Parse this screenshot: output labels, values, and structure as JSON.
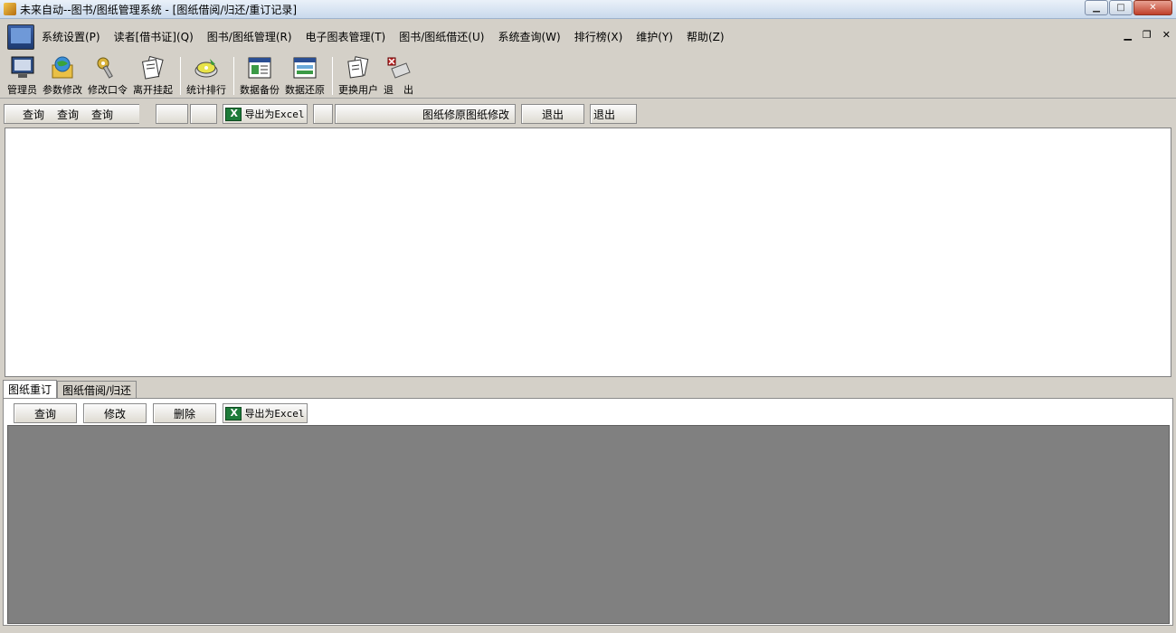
{
  "window": {
    "title": "未来自动--图书/图纸管理系统 - [图纸借阅/归还/重订记录]"
  },
  "menu": {
    "items": [
      "系统设置(P)",
      "读者[借书证](Q)",
      "图书/图纸管理(R)",
      "电子图表管理(T)",
      "图书/图纸借还(U)",
      "系统查询(W)",
      "排行榜(X)",
      "维护(Y)",
      "帮助(Z)"
    ]
  },
  "toolbar": {
    "tools": [
      {
        "label": "管理员",
        "icon": "admin-monitor-icon"
      },
      {
        "label": "参数修改",
        "icon": "globe-folder-icon"
      },
      {
        "label": "修改口令",
        "icon": "key-icon"
      },
      {
        "label": "离开挂起",
        "icon": "documents-icon"
      },
      {
        "label": "统计排行",
        "icon": "disc-icon"
      },
      {
        "label": "数据备份",
        "icon": "window-backup-icon"
      },
      {
        "label": "数据还原",
        "icon": "window-restore-icon"
      },
      {
        "label": "更换用户",
        "icon": "user-docs-icon"
      },
      {
        "label": "退　出",
        "icon": "exit-icon"
      }
    ]
  },
  "top_buttons": {
    "query1": "查询",
    "query2": "查询",
    "query3": "查询",
    "export": "导出为Excel",
    "modify": "图纸修原图纸修改",
    "exit1": "退出",
    "exit2": "退出"
  },
  "tabs": [
    "图纸重订",
    "图纸借阅/归还"
  ],
  "bottom_buttons": {
    "query": "查询",
    "modify": "修改",
    "delete": "删除",
    "export": "导出为Excel"
  },
  "colors": {
    "grid_bg": "#808080",
    "panel_bg": "#ffffff",
    "chrome": "#d4d0c8"
  }
}
